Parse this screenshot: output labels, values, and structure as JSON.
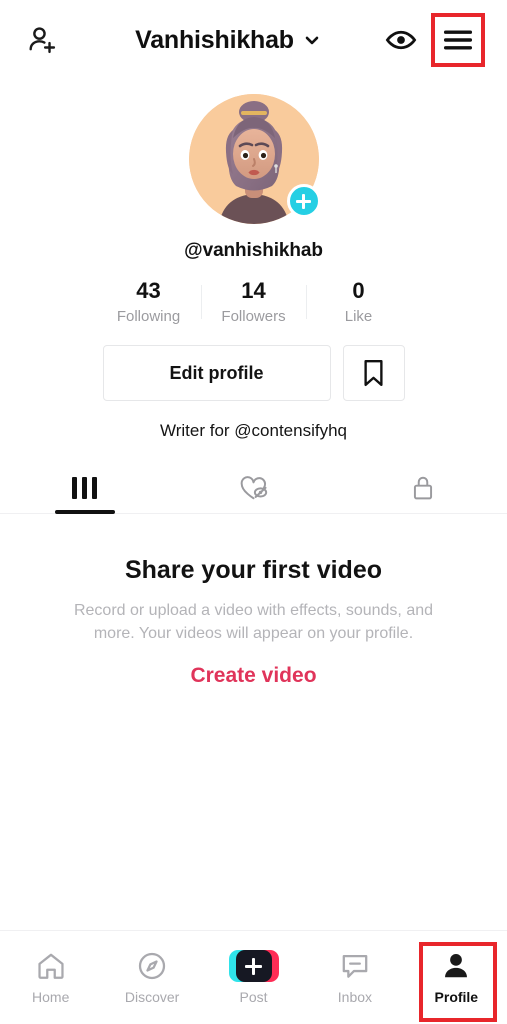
{
  "header": {
    "add_friend_icon": "add-person-icon",
    "title": "Vanhishikhab",
    "dropdown_icon": "chevron-down-icon",
    "eye_icon": "eye-icon",
    "menu_icon": "hamburger-menu-icon",
    "highlight_color": "#e8262b"
  },
  "profile": {
    "avatar_alt": "avatar-3d-woman-bun",
    "avatar_bg": "#f8c99a",
    "follow_badge_icon": "plus-icon",
    "follow_badge_color": "#25cfe4",
    "handle": "@vanhishikhab",
    "stats": [
      {
        "value": "43",
        "label": "Following"
      },
      {
        "value": "14",
        "label": "Followers"
      },
      {
        "value": "0",
        "label": "Like"
      }
    ],
    "edit_profile_label": "Edit profile",
    "bookmark_icon": "bookmark-icon",
    "bio": "Writer for @contensifyhq"
  },
  "tabs": [
    {
      "name": "videos",
      "icon": "grid-columns-icon",
      "active": true
    },
    {
      "name": "liked",
      "icon": "heart-hidden-icon",
      "active": false
    },
    {
      "name": "private",
      "icon": "lock-icon",
      "active": false
    }
  ],
  "empty_state": {
    "title": "Share your first video",
    "subtitle": "Record or upload a video with effects, sounds, and more. Your videos will appear on your profile.",
    "cta_label": "Create video",
    "cta_color": "#e0345a"
  },
  "bottom_nav": [
    {
      "label": "Home",
      "icon": "home-icon",
      "active": false,
      "highlighted": false
    },
    {
      "label": "Discover",
      "icon": "compass-icon",
      "active": false,
      "highlighted": false
    },
    {
      "label": "Post",
      "icon": "plus-box-icon",
      "active": false,
      "highlighted": false
    },
    {
      "label": "Inbox",
      "icon": "message-icon",
      "active": false,
      "highlighted": false
    },
    {
      "label": "Profile",
      "icon": "person-icon",
      "active": true,
      "highlighted": true
    }
  ]
}
